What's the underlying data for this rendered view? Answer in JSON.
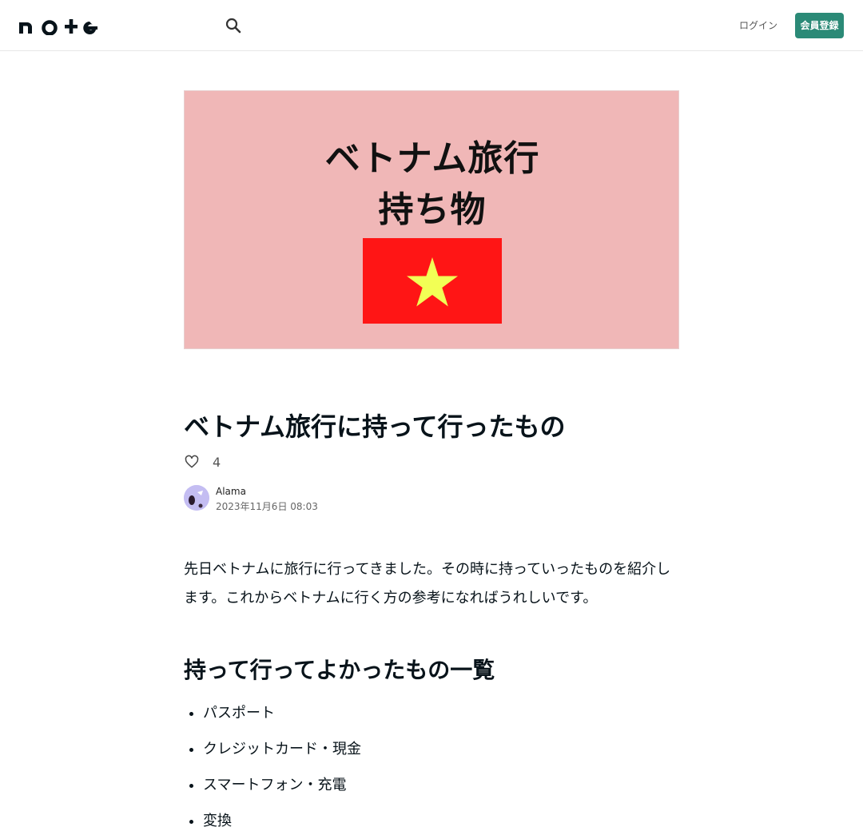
{
  "header": {
    "login_label": "ログイン",
    "signup_label": "会員登録"
  },
  "eyecatch": {
    "line1": "ベトナム旅行",
    "line2": "持ち物"
  },
  "article": {
    "title": "ベトナム旅行に持って行ったもの",
    "like_count": "4",
    "author": "Alama",
    "date": "2023年11月6日 08:03",
    "intro": "先日ベトナムに旅行に行ってきました。その時に持っていったものを紹介します。これからベトナムに行く方の参考になればうれしいです。",
    "heading": "持って行ってよかったもの一覧",
    "items": [
      "パスポート",
      "クレジットカード・現金",
      "スマートフォン・充電",
      "変換"
    ]
  },
  "colors": {
    "accent": "#2b8a77",
    "eyecatch_bg": "#f0b7b7",
    "flag_red": "#ff1515",
    "flag_star": "#f2ff55"
  }
}
